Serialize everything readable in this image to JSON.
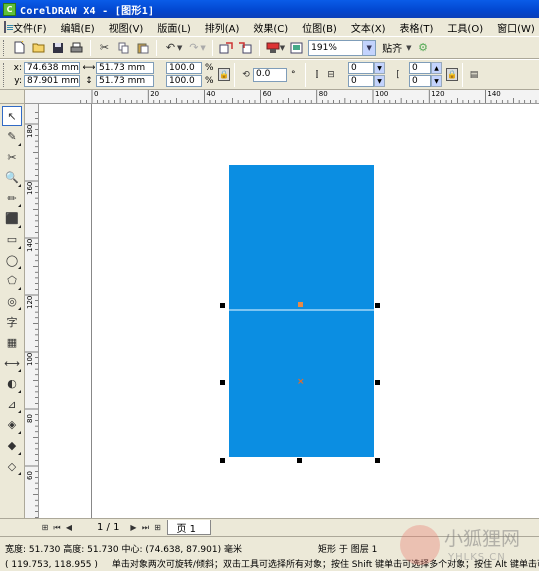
{
  "window": {
    "title": "CorelDRAW X4 - [图形1]",
    "icon_label": "C"
  },
  "menu": [
    "文件(F)",
    "编辑(E)",
    "视图(V)",
    "版面(L)",
    "排列(A)",
    "效果(C)",
    "位图(B)",
    "文本(X)",
    "表格(T)",
    "工具(O)",
    "窗口(W)",
    "帮助"
  ],
  "toolbar": {
    "zoom_value": "191%",
    "snap_label": "贴齐",
    "icons": [
      "new-icon",
      "open-icon",
      "save-icon",
      "print-icon",
      "cut-icon",
      "copy-icon",
      "paste-icon",
      "undo-icon",
      "redo-icon",
      "import-icon",
      "export-icon",
      "application-launcher-icon",
      "welcome-screen-icon",
      "options-icon"
    ]
  },
  "property_bar": {
    "x_label": "x:",
    "x_value": "74.638 mm",
    "y_label": "y:",
    "y_value": "87.901 mm",
    "width_value": "51.73 mm",
    "height_value": "51.73 mm",
    "scale_x": "100.0",
    "scale_y": "100.0",
    "percent": "%",
    "rotation": "0.0",
    "degree": "°",
    "corner_a": "0",
    "corner_b": "0",
    "corner_c": "0",
    "corner_d": "0"
  },
  "rulers": {
    "horizontal_labels": [
      "0",
      "20",
      "40",
      "60",
      "80",
      "100",
      "120",
      "140"
    ],
    "vertical_labels": [
      "180",
      "160",
      "140",
      "120",
      "100",
      "80",
      "60"
    ]
  },
  "toolbox": [
    "pick-tool-icon",
    "shape-tool-icon",
    "crop-tool-icon",
    "zoom-tool-icon",
    "freehand-tool-icon",
    "smart-fill-icon",
    "rectangle-tool-icon",
    "ellipse-tool-icon",
    "polygon-tool-icon",
    "basic-shapes-icon",
    "text-tool-icon",
    "table-tool-icon",
    "dimension-tool-icon",
    "interactive-blend-icon",
    "eyedropper-tool-icon",
    "outline-tool-icon",
    "fill-tool-icon",
    "interactive-fill-icon"
  ],
  "toolbox_glyphs": [
    "↖",
    "✎",
    "✂",
    "🔍",
    "✏",
    "⬛",
    "▭",
    "◯",
    "⬠",
    "◎",
    "字",
    "▦",
    "⟷",
    "◐",
    "⊿",
    "◈",
    "◆",
    "◇"
  ],
  "pagebar": {
    "page_count": "1 / 1",
    "page_tab": "页 1"
  },
  "status": {
    "dimensions": "宽度: 51.730  高度: 51.730  中心: (74.638, 87.901)  毫米",
    "layer_info": "矩形 于 图层 1",
    "cursor_position": "( 119.753, 118.955 )",
    "hint": "单击对象两次可旋转/倾斜；双击工具可选择所有对象；按住 Shift 键单击可选择多个对象；按住 Alt 键单击可"
  },
  "watermark": {
    "chinese": "小狐狸网",
    "english": "YHLKS.CN"
  },
  "colors": {
    "shape_fill": "#0b8ee2",
    "title_bar": "#0a5ce8",
    "center_mark": "#e98a45"
  }
}
